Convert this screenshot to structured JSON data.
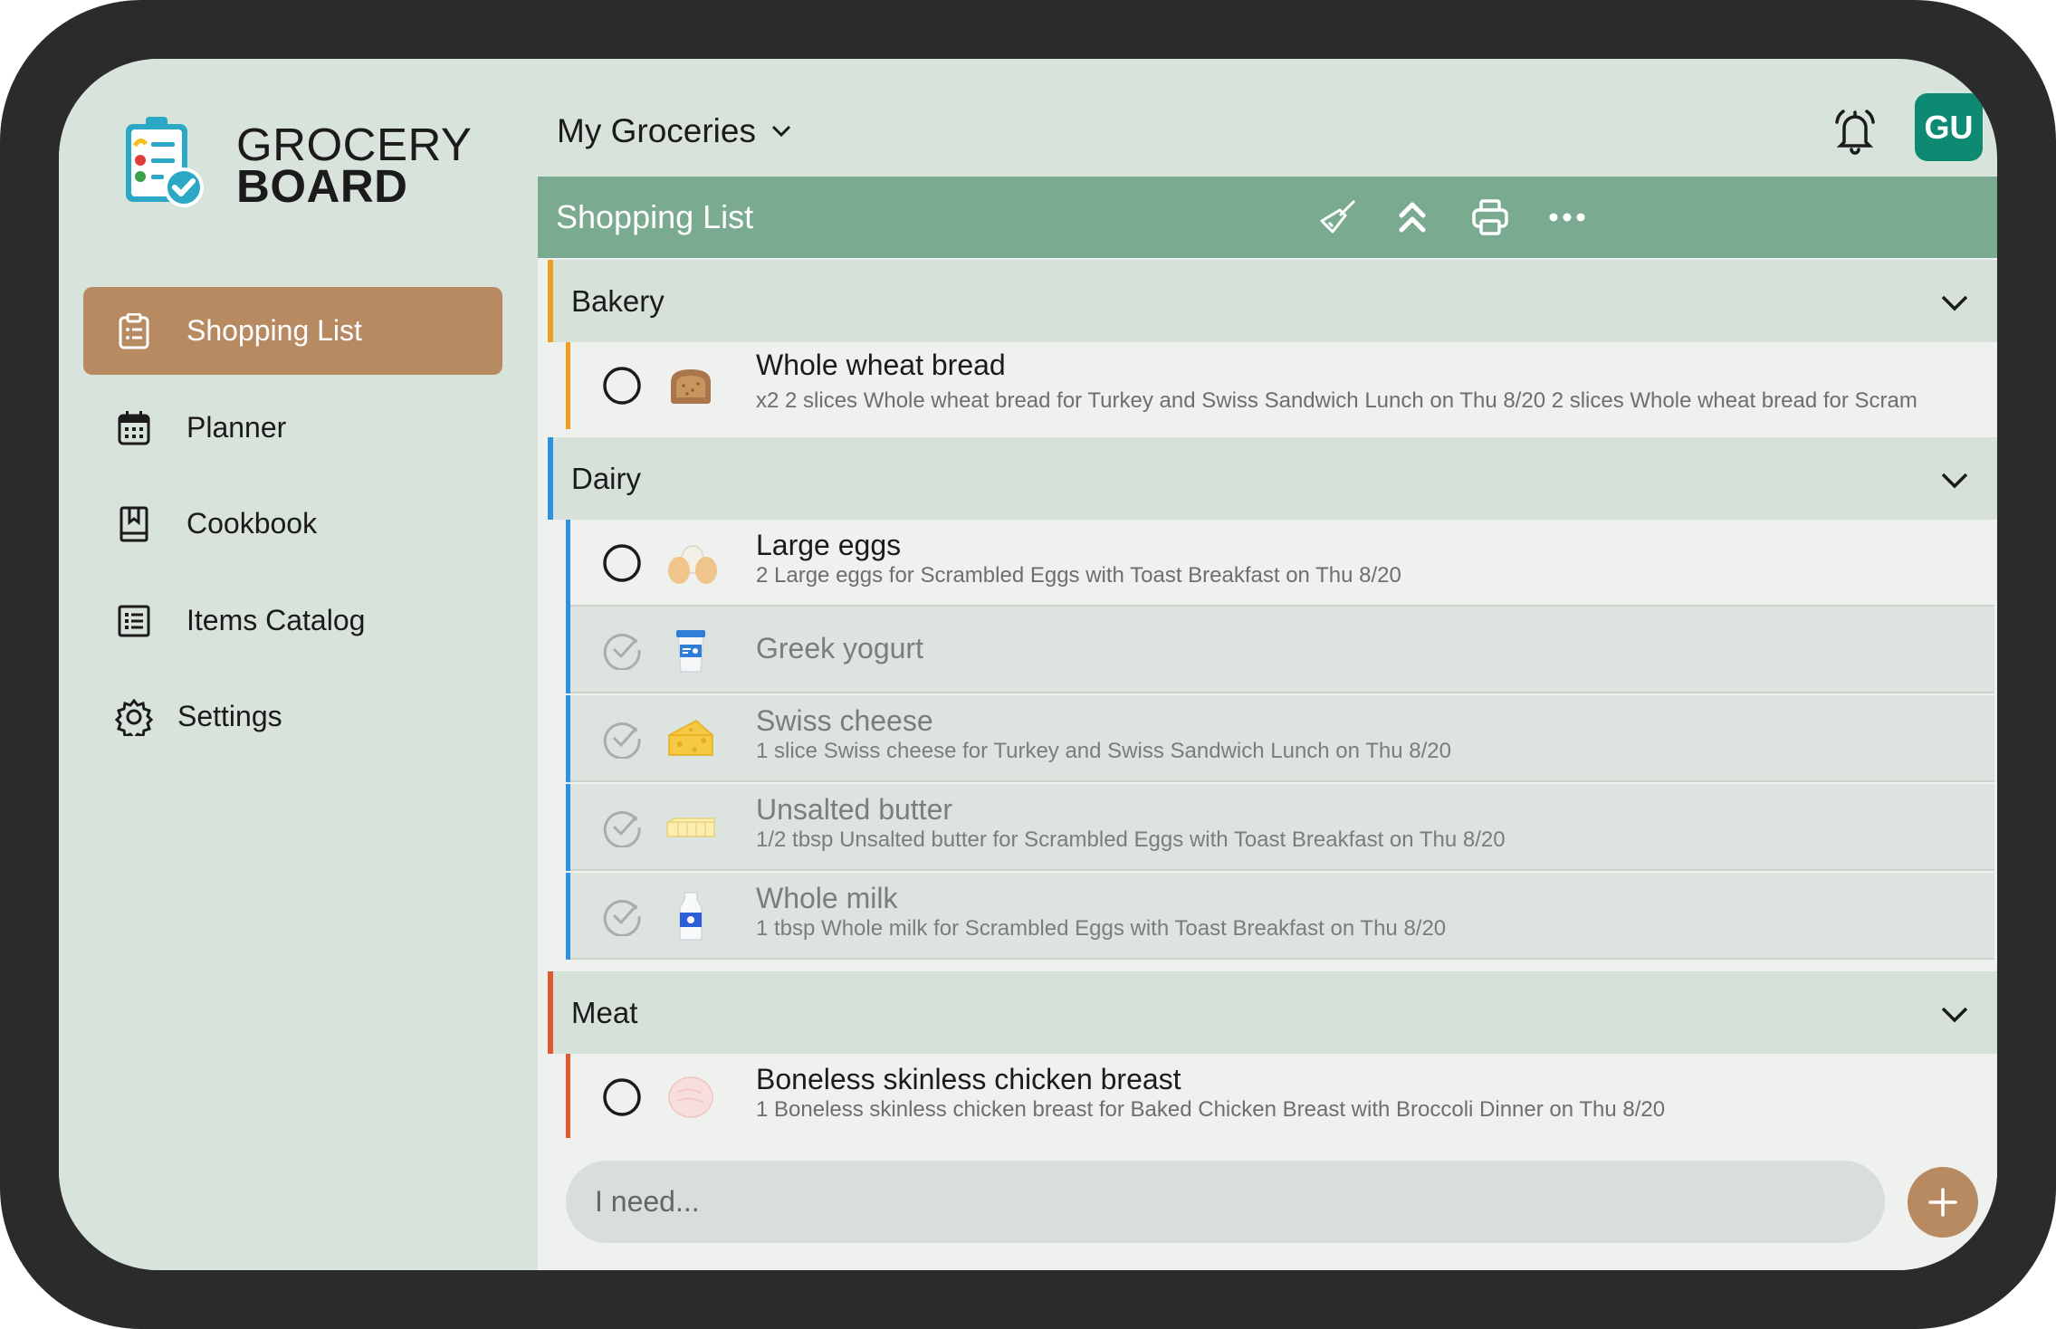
{
  "brand": {
    "line1": "GROCERY",
    "line2": "BOARD"
  },
  "sidebar": {
    "items": [
      {
        "label": "Shopping List",
        "icon": "clipboard-list-icon",
        "active": true
      },
      {
        "label": "Planner",
        "icon": "calendar-icon",
        "active": false
      },
      {
        "label": "Cookbook",
        "icon": "book-icon",
        "active": false
      },
      {
        "label": "Items Catalog",
        "icon": "list-icon",
        "active": false
      },
      {
        "label": "Settings",
        "icon": "gear-icon",
        "active": false
      }
    ]
  },
  "header": {
    "title": "My Groceries",
    "avatar_initials": "GU"
  },
  "toolbar": {
    "title": "Shopping List"
  },
  "categories": [
    {
      "name": "Bakery",
      "color": "#f29c1c"
    },
    {
      "name": "Dairy",
      "color": "#2f8fe0"
    },
    {
      "name": "Meat",
      "color": "#e4572e"
    }
  ],
  "items": {
    "bread": {
      "name": "Whole wheat bread",
      "detail": "x2 2 slices Whole wheat bread for Turkey and Swiss Sandwich Lunch on Thu 8/20 2 slices Whole wheat bread for Scram",
      "checked": false
    },
    "eggs": {
      "name": "Large eggs",
      "detail": "2 Large eggs for Scrambled Eggs with Toast Breakfast on Thu 8/20",
      "checked": false
    },
    "yogurt": {
      "name": "Greek yogurt",
      "detail": "",
      "checked": true
    },
    "cheese": {
      "name": "Swiss cheese",
      "detail": "1 slice Swiss cheese for Turkey and Swiss Sandwich Lunch on Thu 8/20",
      "checked": true
    },
    "butter": {
      "name": "Unsalted butter",
      "detail": "1/2 tbsp Unsalted butter for Scrambled Eggs with Toast Breakfast on Thu 8/20",
      "checked": true
    },
    "milk": {
      "name": "Whole milk",
      "detail": "1 tbsp Whole milk for Scrambled Eggs with Toast Breakfast on Thu 8/20",
      "checked": true
    },
    "chicken": {
      "name": "Boneless skinless chicken breast",
      "detail": "1 Boneless skinless chicken breast for Baked Chicken Breast with Broccoli Dinner on Thu 8/20",
      "checked": false
    }
  },
  "input": {
    "placeholder": "I need..."
  },
  "colors": {
    "accent": "#b88a61",
    "toolbar": "#7aab90",
    "avatar": "#0e8a72"
  }
}
